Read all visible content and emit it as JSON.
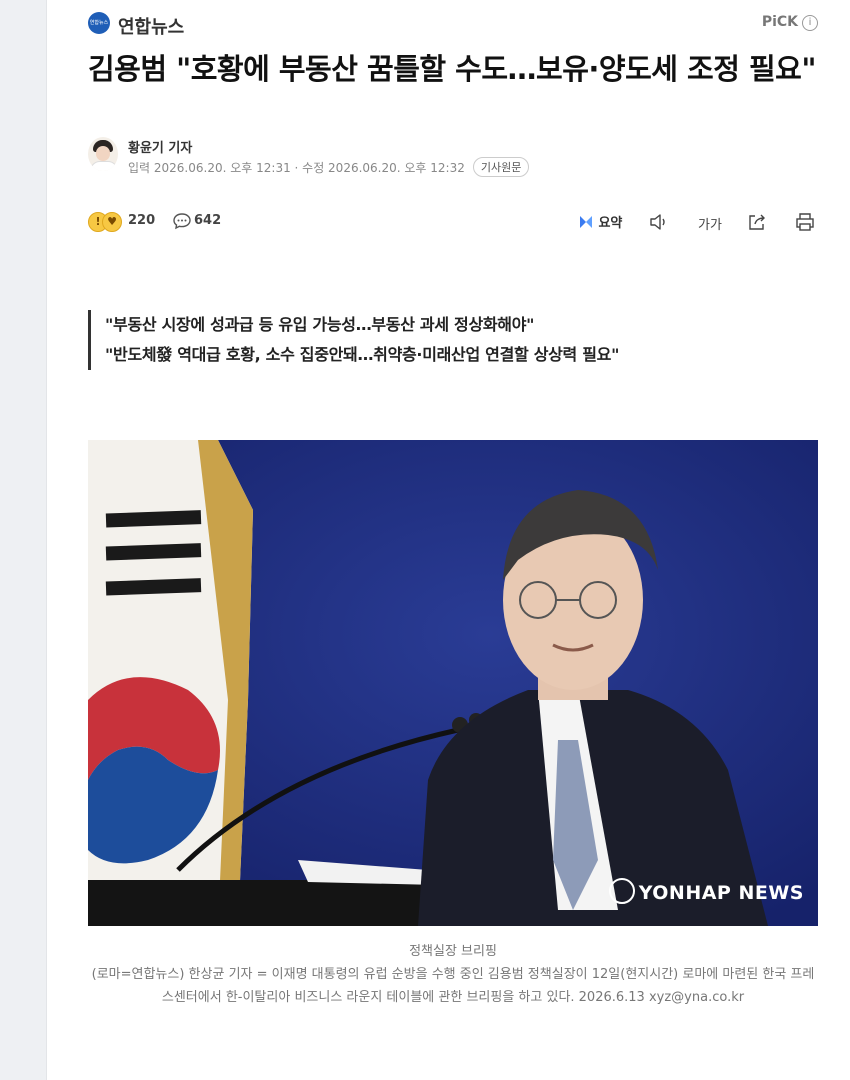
{
  "header": {
    "press_name": "연합뉴스",
    "logo_text": "연합뉴스",
    "pick_label": "PiCK",
    "pick_info": "i"
  },
  "article": {
    "headline": "김용범 \"호황에 부동산 꿈틀할 수도…보유·양도세 조정 필요\"",
    "reporter": "황윤기 기자",
    "dates": "입력 2026.06.20. 오후 12:31 · 수정 2026.06.20. 오후 12:32",
    "origin_button": "기사원문",
    "like_count": "220",
    "comment_count": "642",
    "summary_label": "요약",
    "font_size_label": "가가",
    "subtitles": [
      "\"부동산 시장에 성과급 등 유입 가능성…부동산 과세 정상화해야\"",
      "\"반도체發 역대급 호황, 소수 집중안돼…취약층·미래산업 연결할 상상력 필요\""
    ],
    "photo": {
      "watermark": "YONHAP NEWS"
    },
    "caption_title": "정책실장 브리핑",
    "caption_body": "(로마=연합뉴스) 한상균 기자 = 이재명 대통령의 유럽 순방을 수행 중인 김용범 정책실장이 12일(현지시간) 로마에 마련된 한국 프레스센터에서 한-이탈리아 비즈니스 라운지 테이블에 관한 브리핑을 하고 있다. 2026.6.13 xyz@yna.co.kr"
  },
  "colors": {
    "brand_blue": "#1f5eb7",
    "summary_accent": "#3b7bf0",
    "photo_background": "#1d2e78"
  },
  "icons": [
    "press-logo-icon",
    "info-icon",
    "reaction-emoji-icon",
    "comment-icon",
    "summary-icon",
    "audio-icon",
    "font-size-icon",
    "share-icon",
    "print-icon"
  ]
}
